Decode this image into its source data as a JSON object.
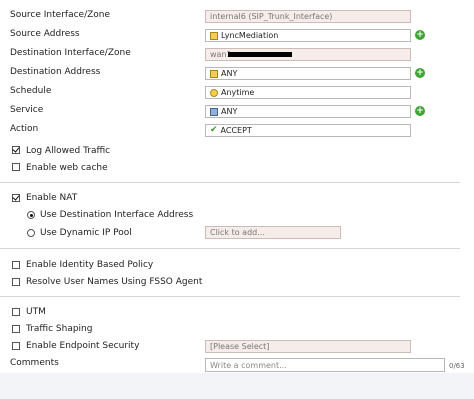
{
  "form": {
    "source_interface": {
      "label": "Source Interface/Zone",
      "value": "internal6 (SIP_Trunk_Interface)"
    },
    "source_address": {
      "label": "Source Address",
      "value": "LyncMediation"
    },
    "destination_interface": {
      "label": "Destination Interface/Zone",
      "value": "wan1"
    },
    "destination_address": {
      "label": "Destination Address",
      "value": "ANY"
    },
    "schedule": {
      "label": "Schedule",
      "value": "Anytime"
    },
    "service": {
      "label": "Service",
      "value": "ANY"
    },
    "action": {
      "label": "Action",
      "value": "ACCEPT"
    }
  },
  "options": {
    "log_allowed_traffic": {
      "label": "Log Allowed Traffic",
      "checked": true
    },
    "enable_web_cache": {
      "label": "Enable web cache",
      "checked": false
    },
    "enable_nat": {
      "label": "Enable NAT",
      "checked": true
    },
    "use_destination_interface": {
      "label": "Use Destination Interface Address",
      "selected": true
    },
    "use_dynamic_ip_pool": {
      "label": "Use Dynamic IP Pool",
      "selected": false,
      "placeholder": "Click to add..."
    },
    "enable_identity_policy": {
      "label": "Enable Identity Based Policy",
      "checked": false
    },
    "resolve_user_names": {
      "label": "Resolve User Names Using FSSO Agent",
      "checked": false
    },
    "utm": {
      "label": "UTM",
      "checked": false
    },
    "traffic_shaping": {
      "label": "Traffic Shaping",
      "checked": false
    },
    "endpoint_security": {
      "label": "Enable Endpoint Security",
      "checked": false,
      "select_value": "[Please Select]"
    }
  },
  "comments": {
    "label": "Comments",
    "placeholder": "Write a comment...",
    "counter": "0/63"
  },
  "icons": {
    "address": "address-object-icon",
    "schedule": "clock-icon",
    "service": "service-object-icon",
    "action": "green-check-icon",
    "add": "green-plus-icon"
  },
  "colors": {
    "add_button": "#3fa535",
    "disabled_field_bg": "#f6ecea",
    "accept_check": "#3c9b2a"
  }
}
